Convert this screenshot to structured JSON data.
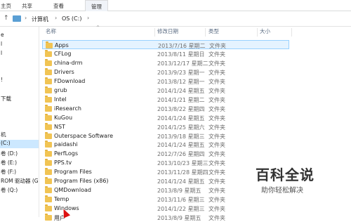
{
  "ribbon": {
    "tabs": [
      "主页",
      "共享",
      "查看",
      "管理"
    ],
    "active": 3
  },
  "address": {
    "root": "计算机",
    "drive": "OS (C:)"
  },
  "nav": {
    "items": [
      {
        "label": "e",
        "selected": false
      },
      {
        "label": "l",
        "selected": false
      },
      {
        "label": "l",
        "selected": false
      },
      {
        "label": "",
        "selected": false
      },
      {
        "label": "",
        "selected": false
      },
      {
        "label": "!",
        "selected": false
      },
      {
        "label": "",
        "selected": false
      },
      {
        "label": "下载",
        "selected": false
      },
      {
        "label": "",
        "selected": false
      },
      {
        "label": "",
        "selected": false
      },
      {
        "label": "",
        "selected": false
      },
      {
        "label": "机",
        "selected": false
      },
      {
        "label": "(C:)",
        "selected": true
      },
      {
        "label": "卷 (D:)",
        "selected": false
      },
      {
        "label": "卷 (E:)",
        "selected": false
      },
      {
        "label": "卷 (F:)",
        "selected": false
      },
      {
        "label": "ROM 驱动器 (G",
        "selected": false
      },
      {
        "label": "卷 (Q:)",
        "selected": false
      }
    ]
  },
  "columns": {
    "name": "名称",
    "date": "修改日期",
    "type": "类型",
    "size": "大小"
  },
  "files": [
    {
      "name": "Apps",
      "date": "2013/7/16 星期二",
      "type": "文件夹",
      "selected": true
    },
    {
      "name": "CFLog",
      "date": "2013/8/11 星期日",
      "type": "文件夹",
      "selected": false
    },
    {
      "name": "china-drm",
      "date": "2013/12/17 星期二",
      "type": "文件夹",
      "selected": false
    },
    {
      "name": "Drivers",
      "date": "2013/9/23 星期一",
      "type": "文件夹",
      "selected": false
    },
    {
      "name": "FDownload",
      "date": "2013/8/12 星期一",
      "type": "文件夹",
      "selected": false
    },
    {
      "name": "grub",
      "date": "2014/1/24 星期五",
      "type": "文件夹",
      "selected": false
    },
    {
      "name": "Intel",
      "date": "2014/1/21 星期二",
      "type": "文件夹",
      "selected": false
    },
    {
      "name": "iResearch",
      "date": "2013/8/22 星期四",
      "type": "文件夹",
      "selected": false
    },
    {
      "name": "KuGou",
      "date": "2014/1/24 星期五",
      "type": "文件夹",
      "selected": false
    },
    {
      "name": "NST",
      "date": "2014/1/25 星期六",
      "type": "文件夹",
      "selected": false
    },
    {
      "name": "Outerspace Software",
      "date": "2013/9/18 星期三",
      "type": "文件夹",
      "selected": false
    },
    {
      "name": "paidashi",
      "date": "2014/1/24 星期五",
      "type": "文件夹",
      "selected": false
    },
    {
      "name": "PerfLogs",
      "date": "2012/7/26 星期四",
      "type": "文件夹",
      "selected": false
    },
    {
      "name": "PPS.tv",
      "date": "2013/10/23 星期三",
      "type": "文件夹",
      "selected": false
    },
    {
      "name": "Program Files",
      "date": "2013/11/28 星期四",
      "type": "文件夹",
      "selected": false
    },
    {
      "name": "Program Files (x86)",
      "date": "2014/1/24 星期五",
      "type": "文件夹",
      "selected": false
    },
    {
      "name": "QMDownload",
      "date": "2013/8/9 星期五",
      "type": "文件夹",
      "selected": false
    },
    {
      "name": "Temp",
      "date": "2013/11/6 星期三",
      "type": "文件夹",
      "selected": false
    },
    {
      "name": "Windows",
      "date": "2014/1/22 星期三",
      "type": "文件夹",
      "selected": false
    },
    {
      "name": "用户",
      "date": "2013/8/9 星期五",
      "type": "文件夹",
      "selected": false
    }
  ],
  "watermark": {
    "title": "百科全说",
    "subtitle": "助你轻松解决"
  }
}
